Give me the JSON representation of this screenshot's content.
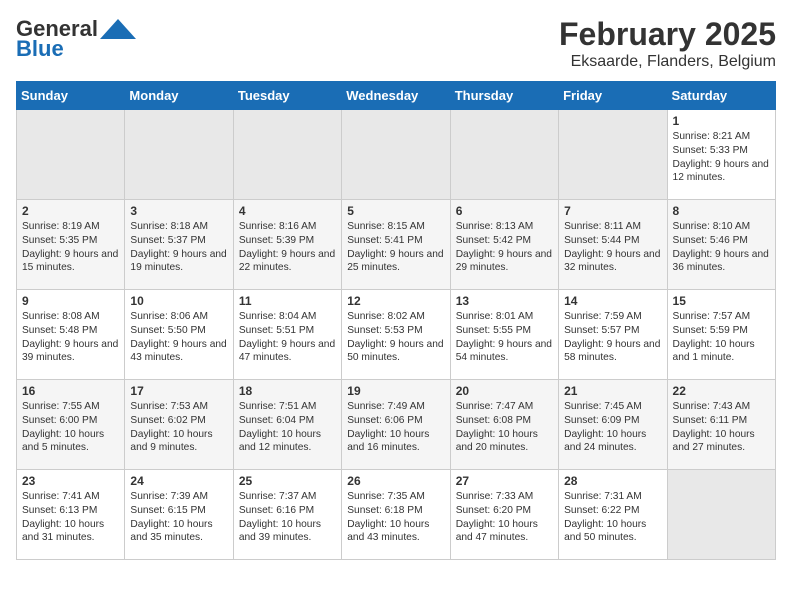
{
  "header": {
    "logo_general": "General",
    "logo_blue": "Blue",
    "title": "February 2025",
    "subtitle": "Eksaarde, Flanders, Belgium"
  },
  "weekdays": [
    "Sunday",
    "Monday",
    "Tuesday",
    "Wednesday",
    "Thursday",
    "Friday",
    "Saturday"
  ],
  "weeks": [
    [
      {
        "day": "",
        "detail": ""
      },
      {
        "day": "",
        "detail": ""
      },
      {
        "day": "",
        "detail": ""
      },
      {
        "day": "",
        "detail": ""
      },
      {
        "day": "",
        "detail": ""
      },
      {
        "day": "",
        "detail": ""
      },
      {
        "day": "1",
        "detail": "Sunrise: 8:21 AM\nSunset: 5:33 PM\nDaylight: 9 hours and 12 minutes."
      }
    ],
    [
      {
        "day": "2",
        "detail": "Sunrise: 8:19 AM\nSunset: 5:35 PM\nDaylight: 9 hours and 15 minutes."
      },
      {
        "day": "3",
        "detail": "Sunrise: 8:18 AM\nSunset: 5:37 PM\nDaylight: 9 hours and 19 minutes."
      },
      {
        "day": "4",
        "detail": "Sunrise: 8:16 AM\nSunset: 5:39 PM\nDaylight: 9 hours and 22 minutes."
      },
      {
        "day": "5",
        "detail": "Sunrise: 8:15 AM\nSunset: 5:41 PM\nDaylight: 9 hours and 25 minutes."
      },
      {
        "day": "6",
        "detail": "Sunrise: 8:13 AM\nSunset: 5:42 PM\nDaylight: 9 hours and 29 minutes."
      },
      {
        "day": "7",
        "detail": "Sunrise: 8:11 AM\nSunset: 5:44 PM\nDaylight: 9 hours and 32 minutes."
      },
      {
        "day": "8",
        "detail": "Sunrise: 8:10 AM\nSunset: 5:46 PM\nDaylight: 9 hours and 36 minutes."
      }
    ],
    [
      {
        "day": "9",
        "detail": "Sunrise: 8:08 AM\nSunset: 5:48 PM\nDaylight: 9 hours and 39 minutes."
      },
      {
        "day": "10",
        "detail": "Sunrise: 8:06 AM\nSunset: 5:50 PM\nDaylight: 9 hours and 43 minutes."
      },
      {
        "day": "11",
        "detail": "Sunrise: 8:04 AM\nSunset: 5:51 PM\nDaylight: 9 hours and 47 minutes."
      },
      {
        "day": "12",
        "detail": "Sunrise: 8:02 AM\nSunset: 5:53 PM\nDaylight: 9 hours and 50 minutes."
      },
      {
        "day": "13",
        "detail": "Sunrise: 8:01 AM\nSunset: 5:55 PM\nDaylight: 9 hours and 54 minutes."
      },
      {
        "day": "14",
        "detail": "Sunrise: 7:59 AM\nSunset: 5:57 PM\nDaylight: 9 hours and 58 minutes."
      },
      {
        "day": "15",
        "detail": "Sunrise: 7:57 AM\nSunset: 5:59 PM\nDaylight: 10 hours and 1 minute."
      }
    ],
    [
      {
        "day": "16",
        "detail": "Sunrise: 7:55 AM\nSunset: 6:00 PM\nDaylight: 10 hours and 5 minutes."
      },
      {
        "day": "17",
        "detail": "Sunrise: 7:53 AM\nSunset: 6:02 PM\nDaylight: 10 hours and 9 minutes."
      },
      {
        "day": "18",
        "detail": "Sunrise: 7:51 AM\nSunset: 6:04 PM\nDaylight: 10 hours and 12 minutes."
      },
      {
        "day": "19",
        "detail": "Sunrise: 7:49 AM\nSunset: 6:06 PM\nDaylight: 10 hours and 16 minutes."
      },
      {
        "day": "20",
        "detail": "Sunrise: 7:47 AM\nSunset: 6:08 PM\nDaylight: 10 hours and 20 minutes."
      },
      {
        "day": "21",
        "detail": "Sunrise: 7:45 AM\nSunset: 6:09 PM\nDaylight: 10 hours and 24 minutes."
      },
      {
        "day": "22",
        "detail": "Sunrise: 7:43 AM\nSunset: 6:11 PM\nDaylight: 10 hours and 27 minutes."
      }
    ],
    [
      {
        "day": "23",
        "detail": "Sunrise: 7:41 AM\nSunset: 6:13 PM\nDaylight: 10 hours and 31 minutes."
      },
      {
        "day": "24",
        "detail": "Sunrise: 7:39 AM\nSunset: 6:15 PM\nDaylight: 10 hours and 35 minutes."
      },
      {
        "day": "25",
        "detail": "Sunrise: 7:37 AM\nSunset: 6:16 PM\nDaylight: 10 hours and 39 minutes."
      },
      {
        "day": "26",
        "detail": "Sunrise: 7:35 AM\nSunset: 6:18 PM\nDaylight: 10 hours and 43 minutes."
      },
      {
        "day": "27",
        "detail": "Sunrise: 7:33 AM\nSunset: 6:20 PM\nDaylight: 10 hours and 47 minutes."
      },
      {
        "day": "28",
        "detail": "Sunrise: 7:31 AM\nSunset: 6:22 PM\nDaylight: 10 hours and 50 minutes."
      },
      {
        "day": "",
        "detail": ""
      }
    ]
  ]
}
